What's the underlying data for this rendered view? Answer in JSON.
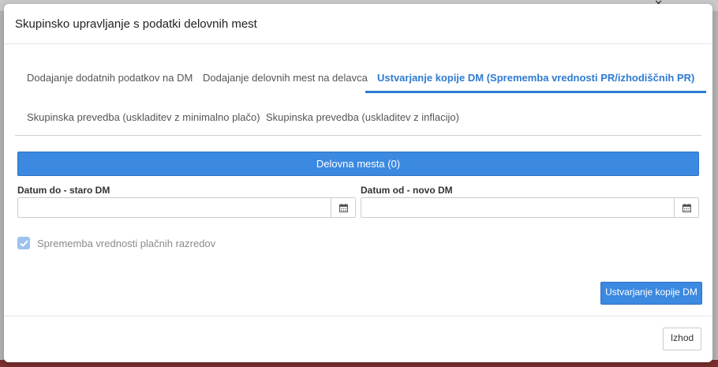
{
  "dialog": {
    "title": "Skupinsko upravljanje s podatki delovnih mest"
  },
  "tabs": [
    {
      "label": "Dodajanje dodatnih podatkov na DM",
      "active": false
    },
    {
      "label": "Dodajanje delovnih mest na delavca",
      "active": false
    },
    {
      "label": "Ustvarjanje kopije DM (Sprememba vrednosti PR/izhodiščnih PR)",
      "active": true
    },
    {
      "label": "Skupinska prevedba (uskladitev z minimalno plačo)",
      "active": false
    },
    {
      "label": "Skupinska prevedba (uskladitev z inflacijo)",
      "active": false
    }
  ],
  "workplaces_button": "Delovna mesta (0)",
  "date_to": {
    "label": "Datum do - staro DM",
    "value": ""
  },
  "date_from": {
    "label": "Datum od - novo DM",
    "value": ""
  },
  "change_pay_grades": {
    "label": "Sprememba vrednosti plačnih razredov",
    "checked": true
  },
  "create_copy_button": "Ustvarjanje kopije DM",
  "exit_button": "Izhod",
  "colors": {
    "accent": "#3b89e0",
    "active_tab": "#2f7bd1",
    "checkbox_disabled": "#9dc2ec"
  },
  "icons": {
    "calendar": "calendar-icon",
    "check": "check-icon"
  }
}
